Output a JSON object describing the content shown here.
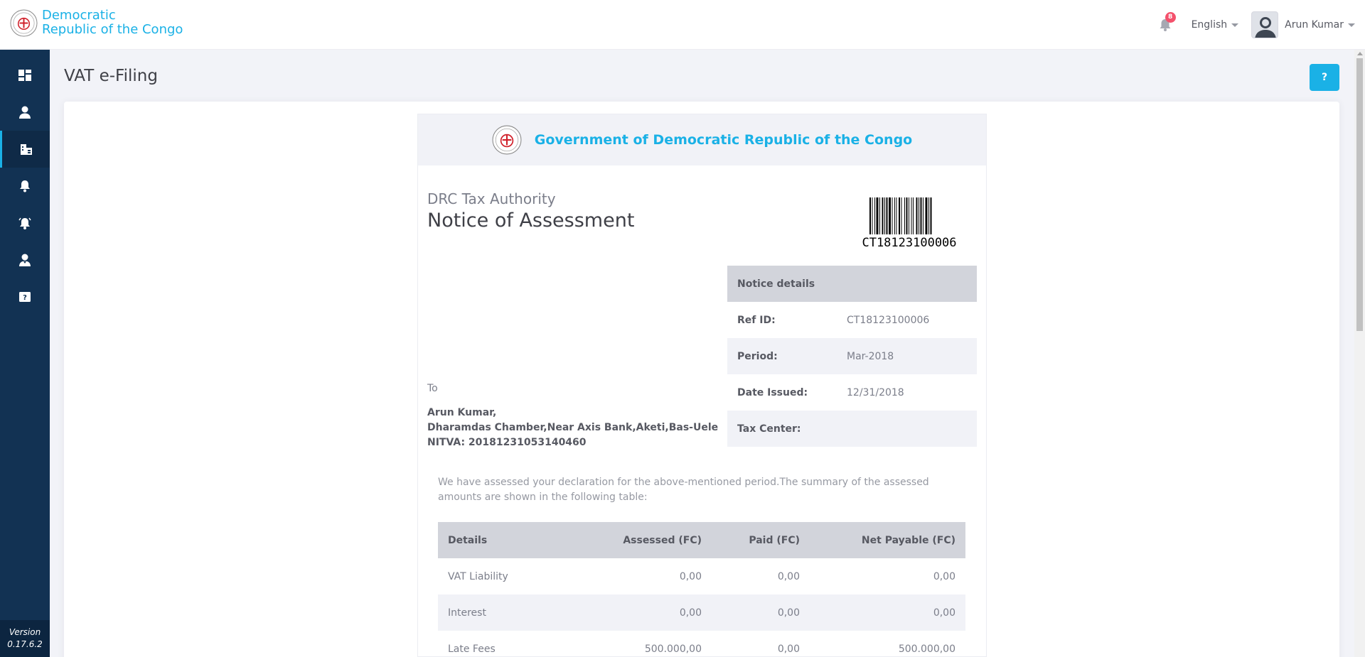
{
  "header": {
    "brand_line1": "Democratic",
    "brand_line2": "Republic of the Congo",
    "notification_count": "8",
    "language": "English",
    "user_name": "Arun Kumar"
  },
  "sidebar": {
    "items": [
      {
        "icon": "dashboard-icon"
      },
      {
        "icon": "user-icon"
      },
      {
        "icon": "building-icon",
        "active": true
      },
      {
        "icon": "bell-icon"
      },
      {
        "icon": "alarm-icon"
      },
      {
        "icon": "support-user-icon"
      },
      {
        "icon": "help-icon"
      }
    ],
    "version_label": "Version",
    "version_number": "0.17.6.2"
  },
  "page": {
    "title": "VAT e-Filing",
    "help_label": "?"
  },
  "document": {
    "header_title": "Government of Democratic Republic of the Congo",
    "authority": "DRC Tax Authority",
    "title": "Notice of Assessment",
    "barcode_text": "CT18123100006",
    "to_label": "To",
    "recipient_name": "Arun Kumar,",
    "recipient_address": "Dharamdas Chamber,Near Axis Bank,Aketi,Bas-Uele",
    "recipient_nitva": "NITVA: 20181231053140460",
    "notice_details": {
      "heading": "Notice details",
      "rows": [
        {
          "key": "Ref ID:",
          "value": "CT18123100006"
        },
        {
          "key": "Period:",
          "value": "Mar-2018"
        },
        {
          "key": "Date Issued:",
          "value": "12/31/2018"
        },
        {
          "key": "Tax Center:",
          "value": ""
        }
      ]
    },
    "intro": "We have assessed your declaration for the above-mentioned period.The summary of the assessed amounts are shown in the following table:",
    "table": {
      "headers": [
        "Details",
        "Assessed (FC)",
        "Paid (FC)",
        "Net Payable (FC)"
      ],
      "rows": [
        [
          "VAT Liability",
          "0,00",
          "0,00",
          "0,00"
        ],
        [
          "Interest",
          "0,00",
          "0,00",
          "0,00"
        ],
        [
          "Late Fees",
          "500.000,00",
          "0,00",
          "500.000,00"
        ]
      ]
    }
  },
  "colors": {
    "brand": "#1ab1e6",
    "sidebar": "#123253",
    "badge": "#f4516c"
  }
}
